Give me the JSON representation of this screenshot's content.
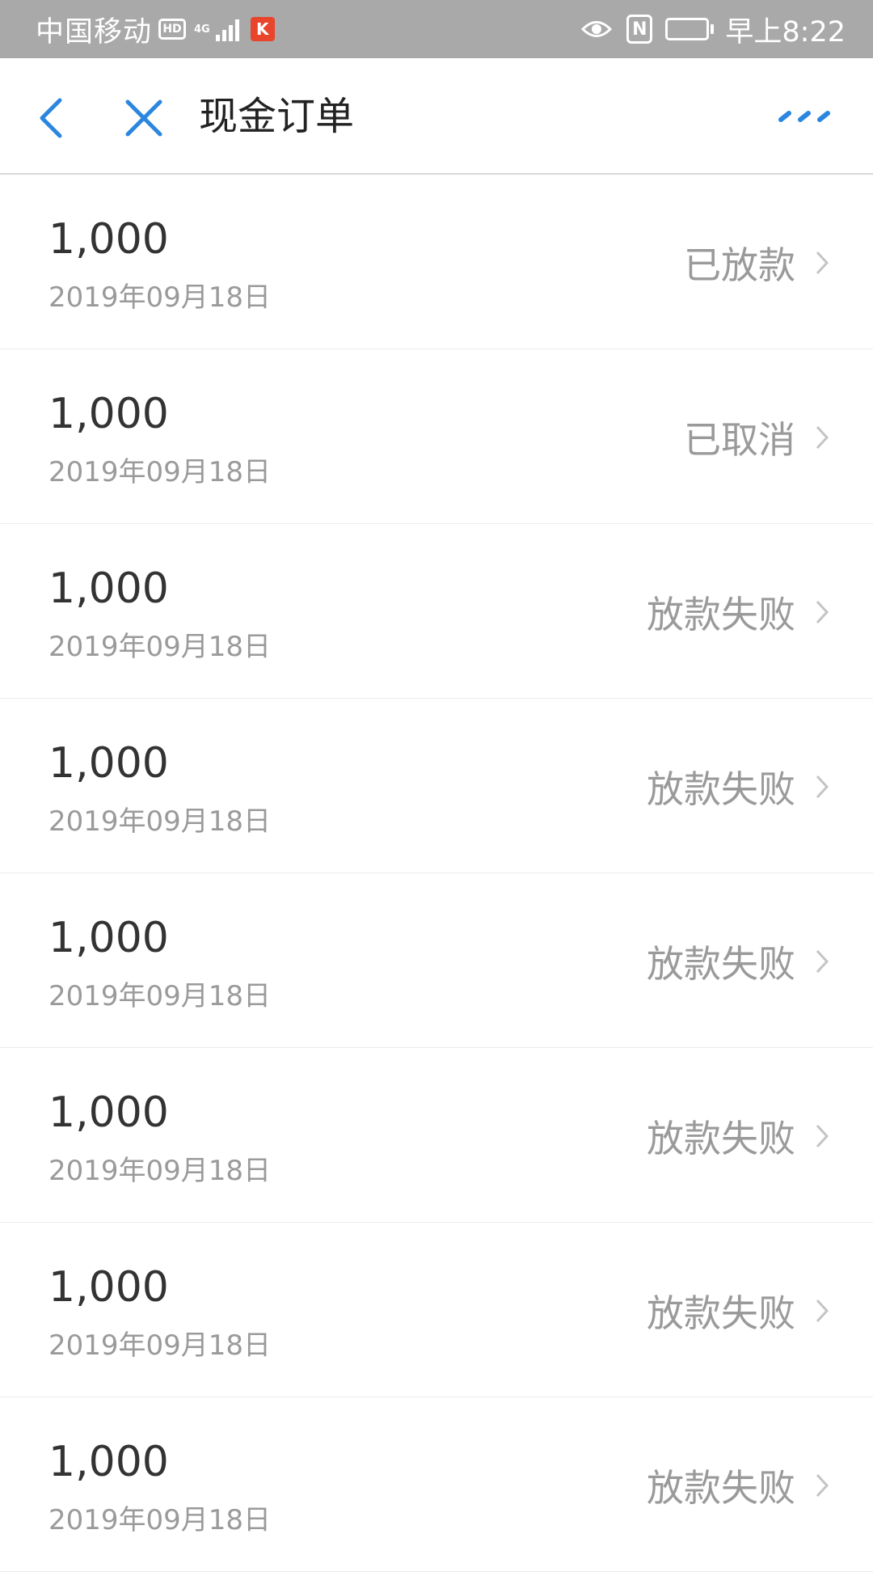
{
  "status_bar": {
    "carrier": "中国移动",
    "hd_label": "HD",
    "network_type": "4G",
    "app_badge": "K",
    "nfc_label": "N",
    "time": "早上8:22"
  },
  "header": {
    "title": "现金订单",
    "back_icon": "chevron-left-icon",
    "close_icon": "close-icon",
    "more_icon": "more-icon",
    "accent_color": "#2a86df"
  },
  "orders": [
    {
      "amount": "1,000",
      "date": "2019年09月18日",
      "status": "已放款"
    },
    {
      "amount": "1,000",
      "date": "2019年09月18日",
      "status": "已取消"
    },
    {
      "amount": "1,000",
      "date": "2019年09月18日",
      "status": "放款失败"
    },
    {
      "amount": "1,000",
      "date": "2019年09月18日",
      "status": "放款失败"
    },
    {
      "amount": "1,000",
      "date": "2019年09月18日",
      "status": "放款失败"
    },
    {
      "amount": "1,000",
      "date": "2019年09月18日",
      "status": "放款失败"
    },
    {
      "amount": "1,000",
      "date": "2019年09月18日",
      "status": "放款失败"
    },
    {
      "amount": "1,000",
      "date": "2019年09月18日",
      "status": "放款失败"
    }
  ]
}
